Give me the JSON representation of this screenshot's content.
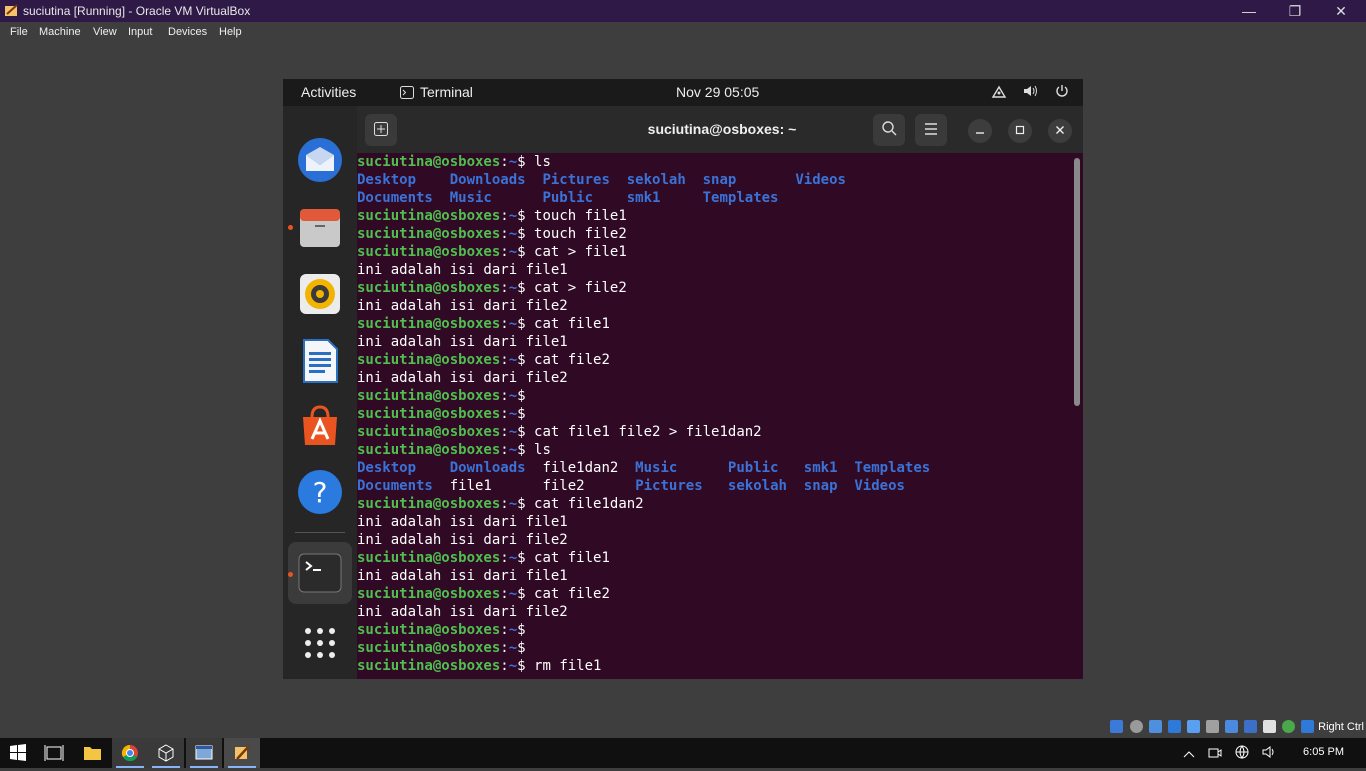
{
  "window": {
    "title": "suciutina [Running] - Oracle VM VirtualBox",
    "minimize": "—",
    "restore": "❐",
    "close": "✕"
  },
  "menubar": {
    "items": [
      "File",
      "Machine",
      "View",
      "Input",
      "Devices",
      "Help"
    ]
  },
  "guest": {
    "topbar": {
      "activities": "Activities",
      "app_name": "Terminal",
      "clock": "Nov 29  05:05"
    },
    "terminal": {
      "title": "suciutina@osboxes: ~",
      "prompt_user": "suciutina@osboxes",
      "prompt_path": "~",
      "prompt_symbol": "$"
    },
    "lines": [
      {
        "type": "cmd",
        "text": " ls"
      },
      {
        "type": "ls",
        "items": [
          [
            "Desktop",
            "dir",
            11
          ],
          [
            "Downloads",
            "dir",
            11
          ],
          [
            "Pictures",
            "dir",
            10
          ],
          [
            "sekolah",
            "dir",
            9
          ],
          [
            "snap",
            "dir",
            11
          ],
          [
            "Videos",
            "dir",
            0
          ]
        ]
      },
      {
        "type": "ls",
        "items": [
          [
            "Documents",
            "dir",
            11
          ],
          [
            "Music",
            "dir",
            11
          ],
          [
            "Public",
            "dir",
            10
          ],
          [
            "smk1",
            "dir",
            9
          ],
          [
            "Templates",
            "dir",
            0
          ]
        ]
      },
      {
        "type": "cmd",
        "text": " touch file1"
      },
      {
        "type": "cmd",
        "text": " touch file2"
      },
      {
        "type": "cmd",
        "text": " cat > file1"
      },
      {
        "type": "out",
        "text": "ini adalah isi dari file1"
      },
      {
        "type": "cmd",
        "text": " cat > file2"
      },
      {
        "type": "out",
        "text": "ini adalah isi dari file2"
      },
      {
        "type": "cmd",
        "text": " cat file1"
      },
      {
        "type": "out",
        "text": "ini adalah isi dari file1"
      },
      {
        "type": "cmd",
        "text": " cat file2"
      },
      {
        "type": "out",
        "text": "ini adalah isi dari file2"
      },
      {
        "type": "cmd",
        "text": ""
      },
      {
        "type": "cmd",
        "text": ""
      },
      {
        "type": "cmd",
        "text": " cat file1 file2 > file1dan2"
      },
      {
        "type": "cmd",
        "text": " ls"
      },
      {
        "type": "ls",
        "items": [
          [
            "Desktop",
            "dir",
            11
          ],
          [
            "Downloads",
            "dir",
            11
          ],
          [
            "file1dan2",
            "reg",
            11
          ],
          [
            "Music",
            "dir",
            11
          ],
          [
            "Public",
            "dir",
            9
          ],
          [
            "smk1",
            "dir",
            6
          ],
          [
            "Templates",
            "dir",
            0
          ]
        ]
      },
      {
        "type": "ls",
        "items": [
          [
            "Documents",
            "dir",
            11
          ],
          [
            "file1",
            "reg",
            11
          ],
          [
            "file2",
            "reg",
            11
          ],
          [
            "Pictures",
            "dir",
            11
          ],
          [
            "sekolah",
            "dir",
            9
          ],
          [
            "snap",
            "dir",
            6
          ],
          [
            "Videos",
            "dir",
            0
          ]
        ]
      },
      {
        "type": "cmd",
        "text": " cat file1dan2"
      },
      {
        "type": "out",
        "text": "ini adalah isi dari file1"
      },
      {
        "type": "out",
        "text": "ini adalah isi dari file2"
      },
      {
        "type": "cmd",
        "text": " cat file1"
      },
      {
        "type": "out",
        "text": "ini adalah isi dari file1"
      },
      {
        "type": "cmd",
        "text": " cat file2"
      },
      {
        "type": "out",
        "text": "ini adalah isi dari file2"
      },
      {
        "type": "cmd",
        "text": ""
      },
      {
        "type": "cmd",
        "text": ""
      },
      {
        "type": "cmd",
        "text": " rm file1"
      }
    ]
  },
  "status": {
    "host_key": "Right Ctrl"
  },
  "taskbar": {
    "time": "6:05 PM"
  },
  "colors": {
    "terminal_bg": "#300a24",
    "prompt_user": "#4fbf4f",
    "dir": "#3b72d8",
    "accent": "#e95420"
  }
}
